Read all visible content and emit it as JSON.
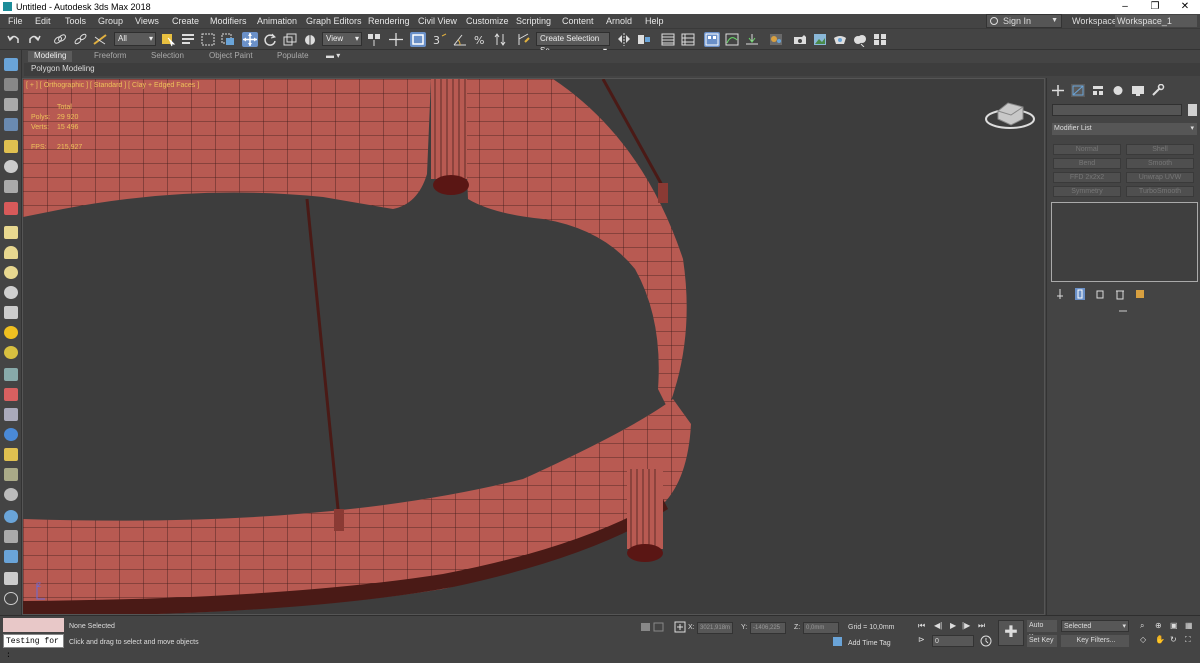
{
  "window": {
    "title": "Untitled - Autodesk 3ds Max 2018",
    "minimize": "–",
    "maximize": "❐",
    "close": "✕"
  },
  "menu": [
    "File",
    "Edit",
    "Tools",
    "Group",
    "Views",
    "Create",
    "Modifiers",
    "Animation",
    "Graph Editors",
    "Rendering",
    "Civil View",
    "Customize",
    "Scripting",
    "Content",
    "Arnold",
    "Help"
  ],
  "account": {
    "signin": "Sign In"
  },
  "workspace": {
    "label": "Workspaces:",
    "value": "Workspace_1"
  },
  "toolbar": {
    "selection_filter": "All",
    "ref_coord": "View",
    "create_selection_set": "Create Selection Se"
  },
  "ribbon": {
    "tabs": [
      "Modeling",
      "Freeform",
      "Selection",
      "Object Paint",
      "Populate"
    ],
    "active_tab": "Modeling",
    "subpanel": "Polygon Modeling"
  },
  "viewport": {
    "label": "[ + ] [ Orthographic ] [ Standard ] [ Clay + Edged Faces ]",
    "stats": {
      "total_label": "Total",
      "polys_label": "Polys:",
      "polys_value": "29 920",
      "verts_label": "Verts:",
      "verts_value": "15 496",
      "fps_label": "FPS:",
      "fps_value": "215,927"
    },
    "axis_label": "z",
    "colors": {
      "background": "#3d3d3d",
      "mesh": "#b85a52",
      "wire": "#3a1a18"
    }
  },
  "command_panel": {
    "modifier_list": "Modifier List",
    "modifier_buttons": [
      "Normal",
      "Shell",
      "Bend",
      "Smooth",
      "FFD 2x2x2",
      "Unwrap UVW",
      "Symmetry",
      "TurboSmooth"
    ]
  },
  "status": {
    "maxscript_output": "Testing for :",
    "selection": "None Selected",
    "prompt": "Click and drag to select and move objects",
    "x_label": "X:",
    "x_value": "3021,918m",
    "y_label": "Y:",
    "y_value": "-1406,225",
    "z_label": "Z:",
    "z_value": "0,0mm",
    "grid": "Grid = 10,0mm",
    "add_time_tag": "Add Time Tag",
    "frame": "0",
    "auto_key": "Auto Key",
    "set_key": "Set Key",
    "key_mode": "Selected",
    "key_filters": "Key Filters..."
  }
}
